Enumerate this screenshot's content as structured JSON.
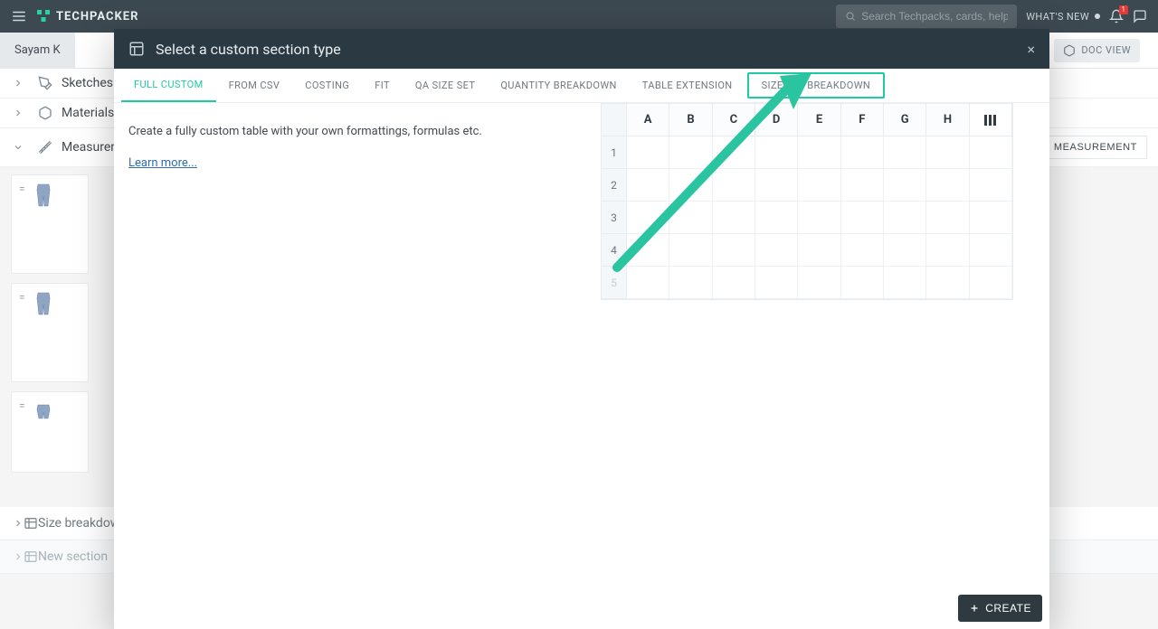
{
  "header": {
    "brand": "TECHPACKER",
    "search_placeholder": "Search Techpacks, cards, help...",
    "whats_new": "WHAT'S NEW",
    "notif_count": "1"
  },
  "page": {
    "crumb_user": "Sayam K",
    "doc_view": "DOC VIEW",
    "add_measurement": "ADD MEASUREMENT",
    "sections": {
      "sketches": "Sketches",
      "materials": "Materials",
      "measurements": "Measurements",
      "size_breakdown": "Size breakdown",
      "new_section": "New section"
    }
  },
  "modal": {
    "title": "Select a custom section type",
    "tabs": {
      "full_custom": "FULL CUSTOM",
      "from_csv": "FROM CSV",
      "costing": "COSTING",
      "fit": "FIT",
      "qa_size_set": "QA SIZE SET",
      "quantity_breakdown": "QUANTITY BREAKDOWN",
      "table_extension": "TABLE EXTENSION",
      "size_set_breakdown": "SIZE SET BREAKDOWN"
    },
    "description": "Create a fully custom table with your own formattings, formulas etc.",
    "learn_more": "Learn more...",
    "sheet": {
      "cols": [
        "A",
        "B",
        "C",
        "D",
        "E",
        "F",
        "G",
        "H"
      ],
      "rows": [
        "1",
        "2",
        "3",
        "4",
        "5"
      ]
    },
    "create": "CREATE"
  }
}
